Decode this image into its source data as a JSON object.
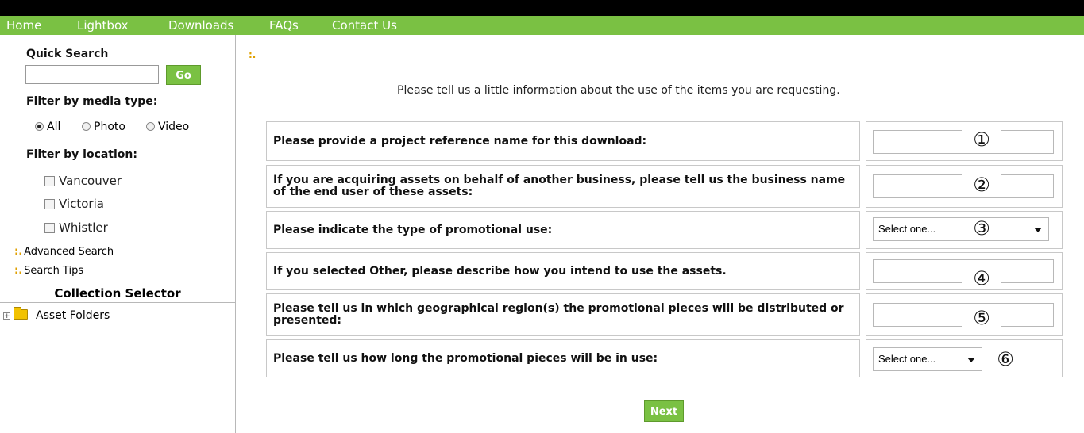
{
  "nav": {
    "home": "Home",
    "lightbox": "Lightbox",
    "downloads": "Downloads",
    "faqs": "FAQs",
    "contact": "Contact Us"
  },
  "sidebar": {
    "quick_search_label": "Quick Search",
    "search_value": "",
    "go_label": "Go",
    "filter_media_label": "Filter by media type:",
    "media_options": [
      "All",
      "Photo",
      "Video"
    ],
    "media_selected": "All",
    "filter_location_label": "Filter by location:",
    "locations": [
      "Vancouver",
      "Victoria",
      "Whistler"
    ],
    "advanced_search": "Advanced Search",
    "search_tips": "Search Tips",
    "collection_selector": "Collection Selector",
    "asset_folders": "Asset Folders"
  },
  "main": {
    "bullet": ":.",
    "intro": "Please tell us a little information about the use of the items you are requesting.",
    "questions": [
      {
        "label": "Please provide a project reference name for this download:",
        "input": "text",
        "value": "",
        "marker": "①"
      },
      {
        "label": "If you are acquiring assets on behalf of another business, please tell us the business name of the end user of these assets:",
        "input": "text",
        "value": "",
        "marker": "②"
      },
      {
        "label": "Please indicate the type of promotional use:",
        "input": "select",
        "value": "Select one...",
        "marker": "③"
      },
      {
        "label": "If you selected Other, please describe how you intend to use the assets.",
        "input": "text",
        "value": "",
        "marker": "④"
      },
      {
        "label": "Please tell us in which geographical region(s) the promotional pieces will be distributed or presented:",
        "input": "text",
        "value": "",
        "marker": "⑤"
      },
      {
        "label": "Please tell us how long the promotional pieces will be in use:",
        "input": "select",
        "value": "Select one...",
        "marker": "⑥"
      }
    ],
    "next_label": "Next"
  },
  "colors": {
    "nav_green": "#7ac143",
    "bullet_gold": "#e0a000"
  }
}
